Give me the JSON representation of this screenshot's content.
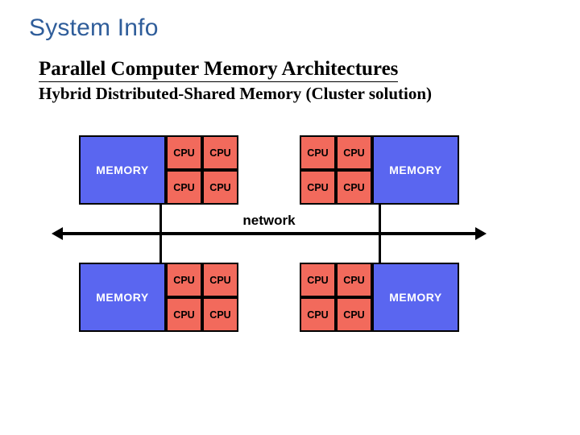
{
  "page_title": "System Info",
  "heading": "Parallel Computer Memory Architectures",
  "subheading": "Hybrid Distributed-Shared Memory (Cluster solution)",
  "diagram": {
    "memory_label": "MEMORY",
    "cpu_label": "CPU",
    "network_label": "network",
    "nodes": [
      {
        "position": "top-left",
        "memory_side": "left",
        "cpus": 4
      },
      {
        "position": "top-right",
        "memory_side": "right",
        "cpus": 4
      },
      {
        "position": "bottom-left",
        "memory_side": "left",
        "cpus": 4
      },
      {
        "position": "bottom-right",
        "memory_side": "right",
        "cpus": 4
      }
    ],
    "colors": {
      "memory_fill": "#5a66f0",
      "cpu_fill": "#f26a5c",
      "border": "#000000"
    }
  }
}
